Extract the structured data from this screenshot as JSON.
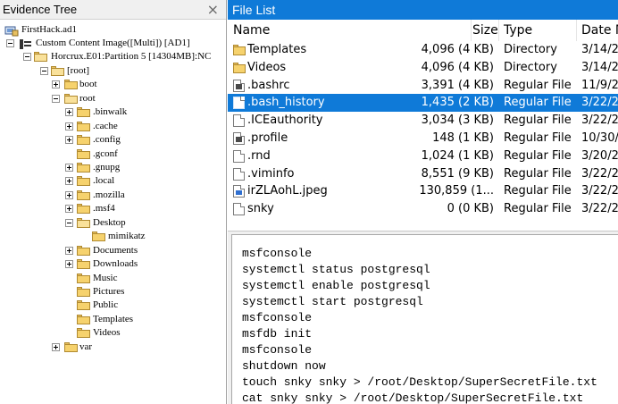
{
  "evidence_tree": {
    "title": "Evidence Tree",
    "close_icon": "close-icon",
    "nodes": [
      {
        "label": "FirstHack.ad1",
        "icon": "evidence-icon",
        "expanded": true
      },
      {
        "label": "Custom Content Image([Multi]) [AD1]",
        "icon": "content-image-icon",
        "expanded": true
      },
      {
        "label": "Horcrux.E01:Partition 5 [14304MB]:NC",
        "icon": "folder-icon",
        "expanded": true
      },
      {
        "label": "[root]",
        "icon": "folder-icon",
        "expanded": true
      },
      {
        "label": "boot",
        "icon": "folder-icon",
        "expanded": false
      },
      {
        "label": "root",
        "icon": "folder-icon",
        "expanded": true
      },
      {
        "label": ".binwalk",
        "icon": "folder-icon",
        "expanded": false
      },
      {
        "label": ".cache",
        "icon": "folder-icon",
        "expanded": false
      },
      {
        "label": ".config",
        "icon": "folder-icon",
        "expanded": false
      },
      {
        "label": ".gconf",
        "icon": "folder-icon",
        "expanded": null
      },
      {
        "label": ".gnupg",
        "icon": "folder-icon",
        "expanded": false
      },
      {
        "label": ".local",
        "icon": "folder-icon",
        "expanded": false
      },
      {
        "label": ".mozilla",
        "icon": "folder-icon",
        "expanded": false
      },
      {
        "label": ".msf4",
        "icon": "folder-icon",
        "expanded": false
      },
      {
        "label": "Desktop",
        "icon": "folder-icon",
        "expanded": true
      },
      {
        "label": "mimikatz",
        "icon": "folder-icon",
        "expanded": null
      },
      {
        "label": "Documents",
        "icon": "folder-icon",
        "expanded": false
      },
      {
        "label": "Downloads",
        "icon": "folder-icon",
        "expanded": false
      },
      {
        "label": "Music",
        "icon": "folder-icon",
        "expanded": null
      },
      {
        "label": "Pictures",
        "icon": "folder-icon",
        "expanded": null
      },
      {
        "label": "Public",
        "icon": "folder-icon",
        "expanded": null
      },
      {
        "label": "Templates",
        "icon": "folder-icon",
        "expanded": null
      },
      {
        "label": "Videos",
        "icon": "folder-icon",
        "expanded": null
      },
      {
        "label": "var",
        "icon": "folder-icon",
        "expanded": false
      }
    ]
  },
  "file_list": {
    "title": "File List",
    "columns": {
      "name": "Name",
      "size": "Size",
      "type": "Type",
      "date": "Date M"
    },
    "rows": [
      {
        "name": "Templates",
        "size": "4,096 (4 KB)",
        "type": "Directory",
        "date": "3/14/2",
        "icon": "folder-icon",
        "selected": false
      },
      {
        "name": "Videos",
        "size": "4,096 (4 KB)",
        "type": "Directory",
        "date": "3/14/2",
        "icon": "folder-icon",
        "selected": false
      },
      {
        "name": ".bashrc",
        "size": "3,391 (4 KB)",
        "type": "Regular File",
        "date": "11/9/2",
        "icon": "file-icon",
        "selected": false
      },
      {
        "name": ".bash_history",
        "size": "1,435 (2 KB)",
        "type": "Regular File",
        "date": "3/22/2",
        "icon": "file-icon",
        "selected": true
      },
      {
        "name": ".ICEauthority",
        "size": "3,034 (3 KB)",
        "type": "Regular File",
        "date": "3/22/2",
        "icon": "file-icon",
        "selected": false
      },
      {
        "name": ".profile",
        "size": "148 (1 KB)",
        "type": "Regular File",
        "date": "10/30/",
        "icon": "file-icon",
        "selected": false
      },
      {
        "name": ".rnd",
        "size": "1,024 (1 KB)",
        "type": "Regular File",
        "date": "3/20/2",
        "icon": "file-icon",
        "selected": false
      },
      {
        "name": ".viminfo",
        "size": "8,551 (9 KB)",
        "type": "Regular File",
        "date": "3/22/2",
        "icon": "file-icon",
        "selected": false
      },
      {
        "name": "irZLAohL.jpeg",
        "size": "130,859 (1...",
        "type": "Regular File",
        "date": "3/22/2",
        "icon": "image-file-icon",
        "selected": false
      },
      {
        "name": "snky",
        "size": "0 (0 KB)",
        "type": "Regular File",
        "date": "3/22/2",
        "icon": "file-icon",
        "selected": false
      }
    ]
  },
  "viewer": {
    "lines": [
      "msfconsole",
      "systemctl status postgresql",
      "systemctl enable postgresql",
      "systemctl start postgresql",
      "msfconsole",
      "msfdb init",
      "msfconsole",
      "shutdown now",
      "touch snky snky > /root/Desktop/SuperSecretFile.txt",
      "cat snky snky > /root/Desktop/SuperSecretFile.txt"
    ]
  },
  "colors": {
    "selection": "#0f7ad8",
    "folder": "#f6d26d"
  }
}
